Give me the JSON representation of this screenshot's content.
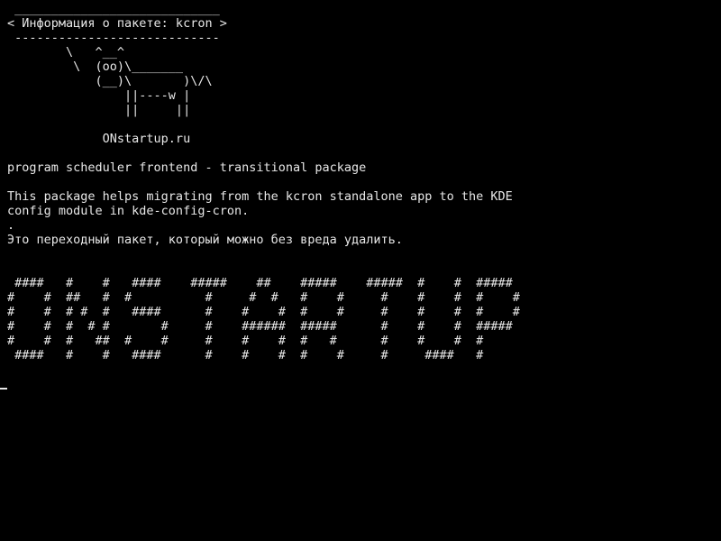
{
  "terminal": {
    "lines": [
      " ____________________________",
      "< Информация о пакете: kcron >",
      " ----------------------------",
      "        \\   ^__^",
      "         \\  (oo)\\_______",
      "            (__)\\       )\\/\\",
      "                ||----w |",
      "                ||     ||",
      "",
      "             ONstartup.ru",
      "",
      "program scheduler frontend - transitional package",
      "",
      "This package helps migrating from the kcron standalone app to the KDE",
      "config module in kde-config-cron.",
      ".",
      "Это переходный пакет, который можно без вреда удалить.",
      "",
      "",
      " ####   #    #   ####    #####    ##    #####    #####  #    #  #####",
      "#    #  ##   #  #          #     #  #   #    #     #    #    #  #    #",
      "#    #  # #  #   ####      #    #    #  #    #     #    #    #  #    #",
      "#    #  #  # #       #     #    ######  #####      #    #    #  #####",
      "#    #  #   ##  #    #     #    #    #  #   #      #    #    #  #",
      " ####   #    #   ####      #    #    #  #    #     #     ####   #"
    ]
  },
  "colors": {
    "background": "#000000",
    "foreground": "#e8e8e8"
  }
}
